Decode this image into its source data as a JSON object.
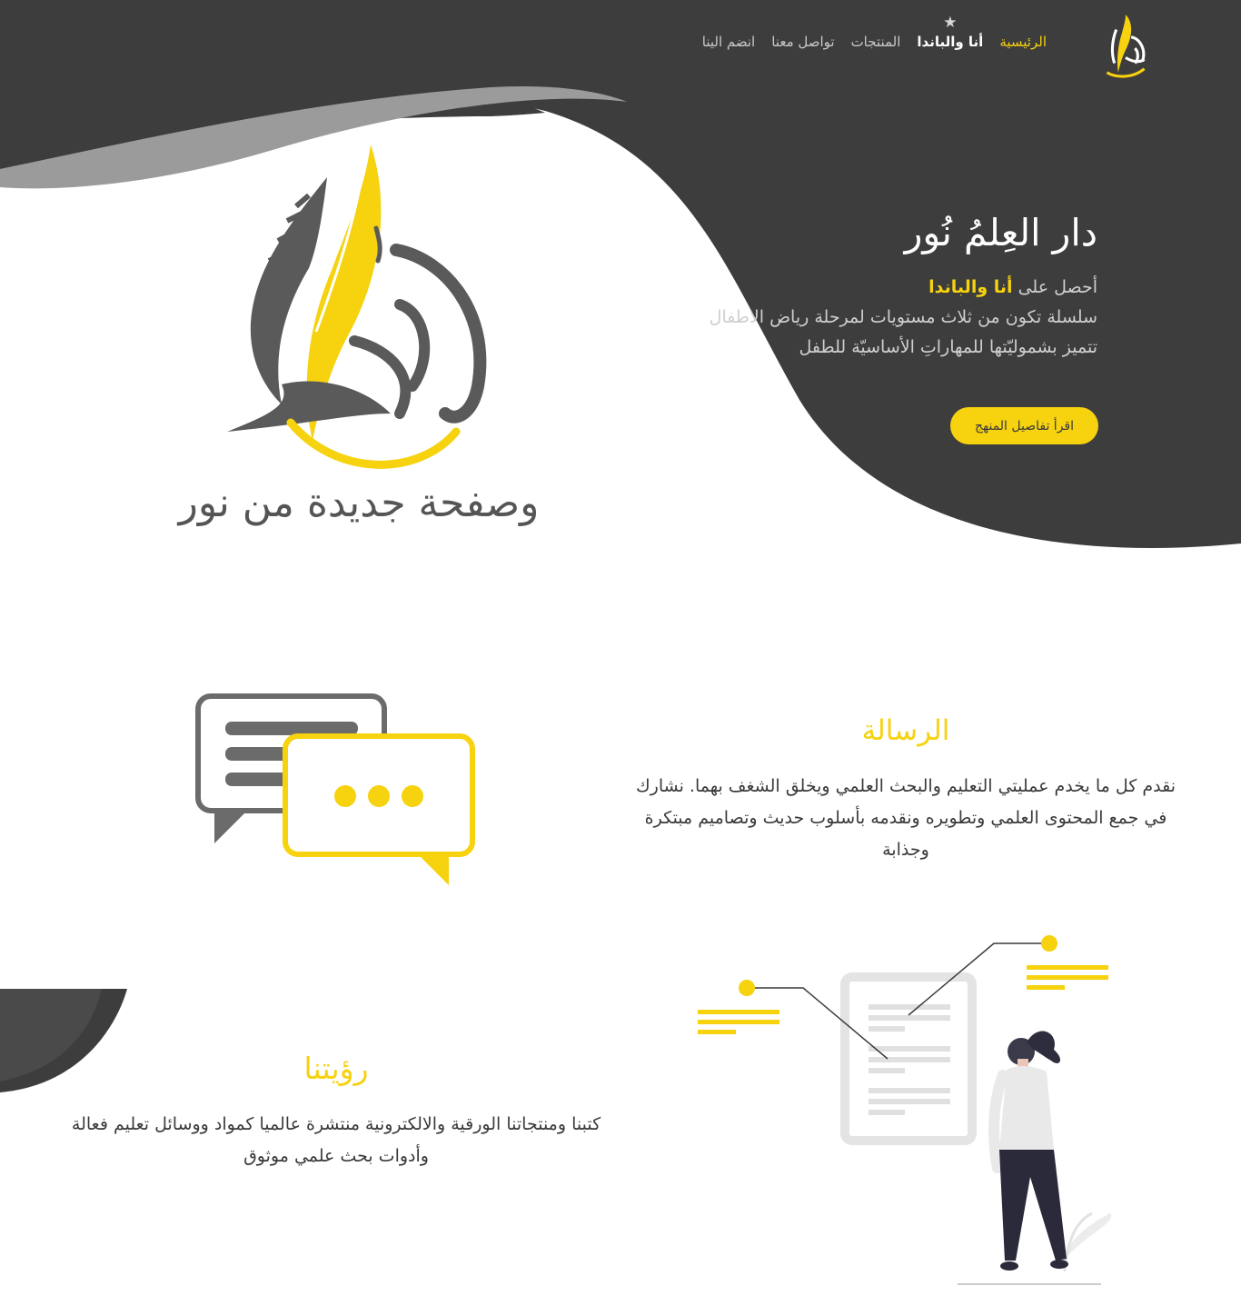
{
  "nav": {
    "items": [
      {
        "label": "الرئيسية",
        "state": "active"
      },
      {
        "label": "أنا والباندا",
        "state": "highlight"
      },
      {
        "label": "المنتجات",
        "state": "normal"
      },
      {
        "label": "تواصل معنا",
        "state": "normal"
      },
      {
        "label": "انضم الينا",
        "state": "normal"
      }
    ]
  },
  "hero": {
    "title": "دار العِلمُ نُور",
    "intro_prefix": "أحصل على",
    "intro_highlight": "أنا والباندا",
    "description": "سلسلة تكون من ثلاث مستويات لمرحلة رياض الاطفال تتميز بشموليّتها للمهاراتِ الأساسيّة للطفل",
    "button_label": "اقرأ تفاصيل المنهج"
  },
  "slogan": "وصفحة جديدة من نور",
  "mission": {
    "title": "الرسالة",
    "text": "نقدم كل ما يخدم عمليتي التعليم والبحث العلمي ويخلق الشغف بهما. نشارك في جمع المحتوى العلمي وتطويره ونقدمه بأسلوب حديث وتصاميم مبتكرة وجذابة"
  },
  "vision": {
    "title": "رؤيتنا",
    "text": "كتبنا ومنتجاتنا الورقية والالكترونية منتشرة عالميا كمواد ووسائل تعليم فعالة وأدوات بحث علمي موثوق"
  },
  "icons": [
    "star-icon",
    "quill-logo-icon",
    "chat-bubbles-illustration",
    "woman-document-illustration"
  ],
  "colors": {
    "accent": "#f6d20f",
    "dark": "#3d3d3d",
    "mid_gray": "#9a9a9a",
    "text": "#3a3a3a",
    "light_text": "#cfcfcf"
  }
}
